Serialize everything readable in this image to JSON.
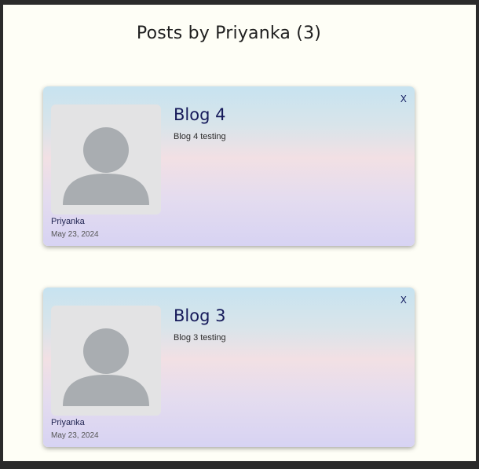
{
  "header": {
    "title": "Posts by Priyanka (3)"
  },
  "posts": [
    {
      "title": "Blog 4",
      "description": "Blog 4 testing",
      "author": "Priyanka",
      "date": "May 23, 2024",
      "close_label": "X",
      "avatar_icon": "user-avatar-placeholder"
    },
    {
      "title": "Blog 3",
      "description": "Blog 3 testing",
      "author": "Priyanka",
      "date": "May 23, 2024",
      "close_label": "X",
      "avatar_icon": "user-avatar-placeholder"
    }
  ],
  "colors": {
    "page_background": "#fefef6",
    "title_text": "#161a5a",
    "avatar_silhouette": "#a9adb1",
    "avatar_background": "#e3e3e4"
  }
}
